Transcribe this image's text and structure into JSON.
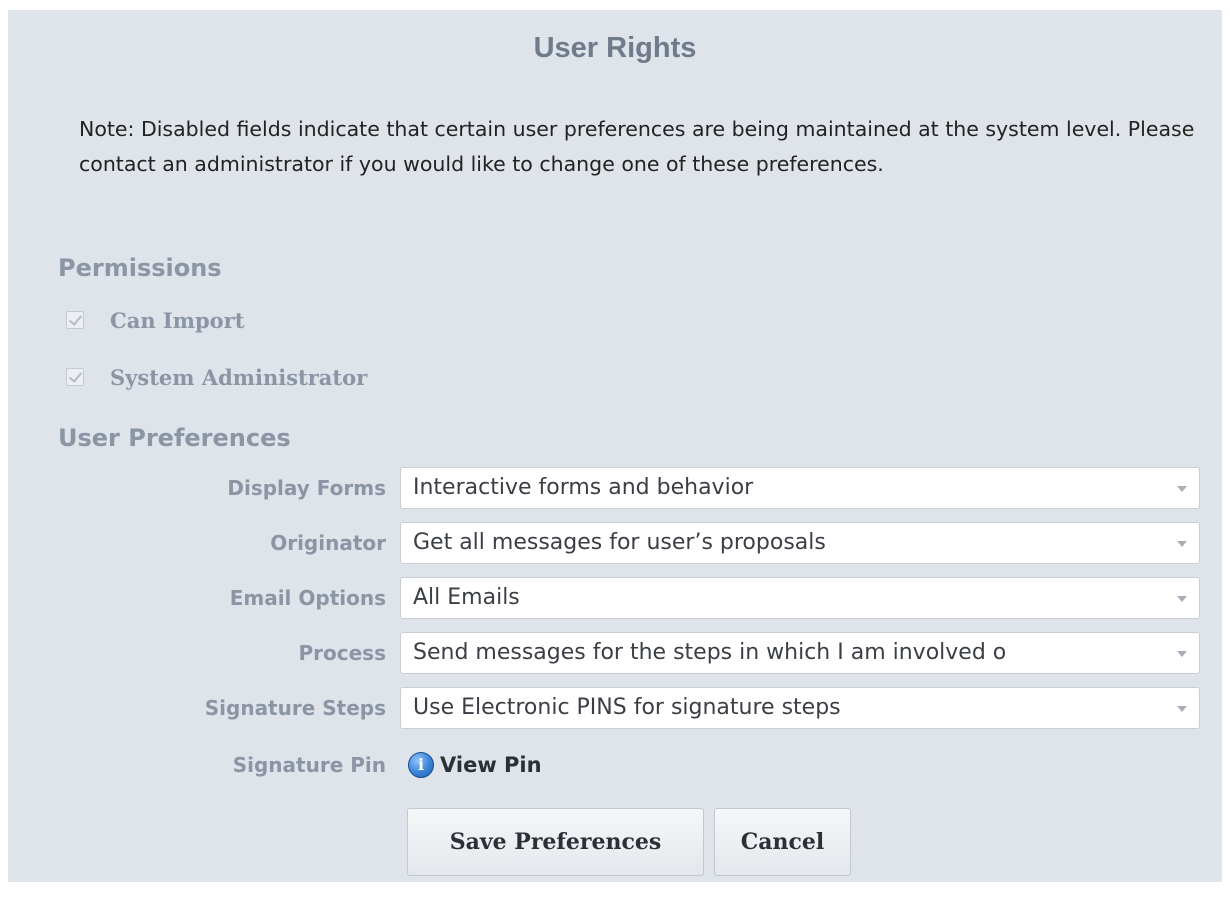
{
  "title": "User Rights",
  "note": "Note: Disabled fields indicate that certain user preferences are being maintained at the system level. Please contact an administrator if you would like to change one of these preferences.",
  "permissions": {
    "heading": "Permissions",
    "items": [
      {
        "label": "Can Import",
        "checked": true,
        "disabled": true
      },
      {
        "label": "System Administrator",
        "checked": true,
        "disabled": true
      }
    ]
  },
  "user_preferences": {
    "heading": "User Preferences",
    "fields": [
      {
        "label": "Display Forms",
        "value": "Interactive forms and behavior"
      },
      {
        "label": "Originator",
        "value": "Get all messages for user’s proposals"
      },
      {
        "label": "Email Options",
        "value": "All Emails"
      },
      {
        "label": "Process",
        "value": "Send messages for the steps in which I am involved o"
      },
      {
        "label": "Signature Steps",
        "value": "Use Electronic PINS for signature steps"
      }
    ],
    "signature_pin": {
      "label": "Signature Pin",
      "link_text": "View Pin",
      "icon": "info-icon"
    }
  },
  "buttons": {
    "save": "Save Preferences",
    "cancel": "Cancel"
  }
}
